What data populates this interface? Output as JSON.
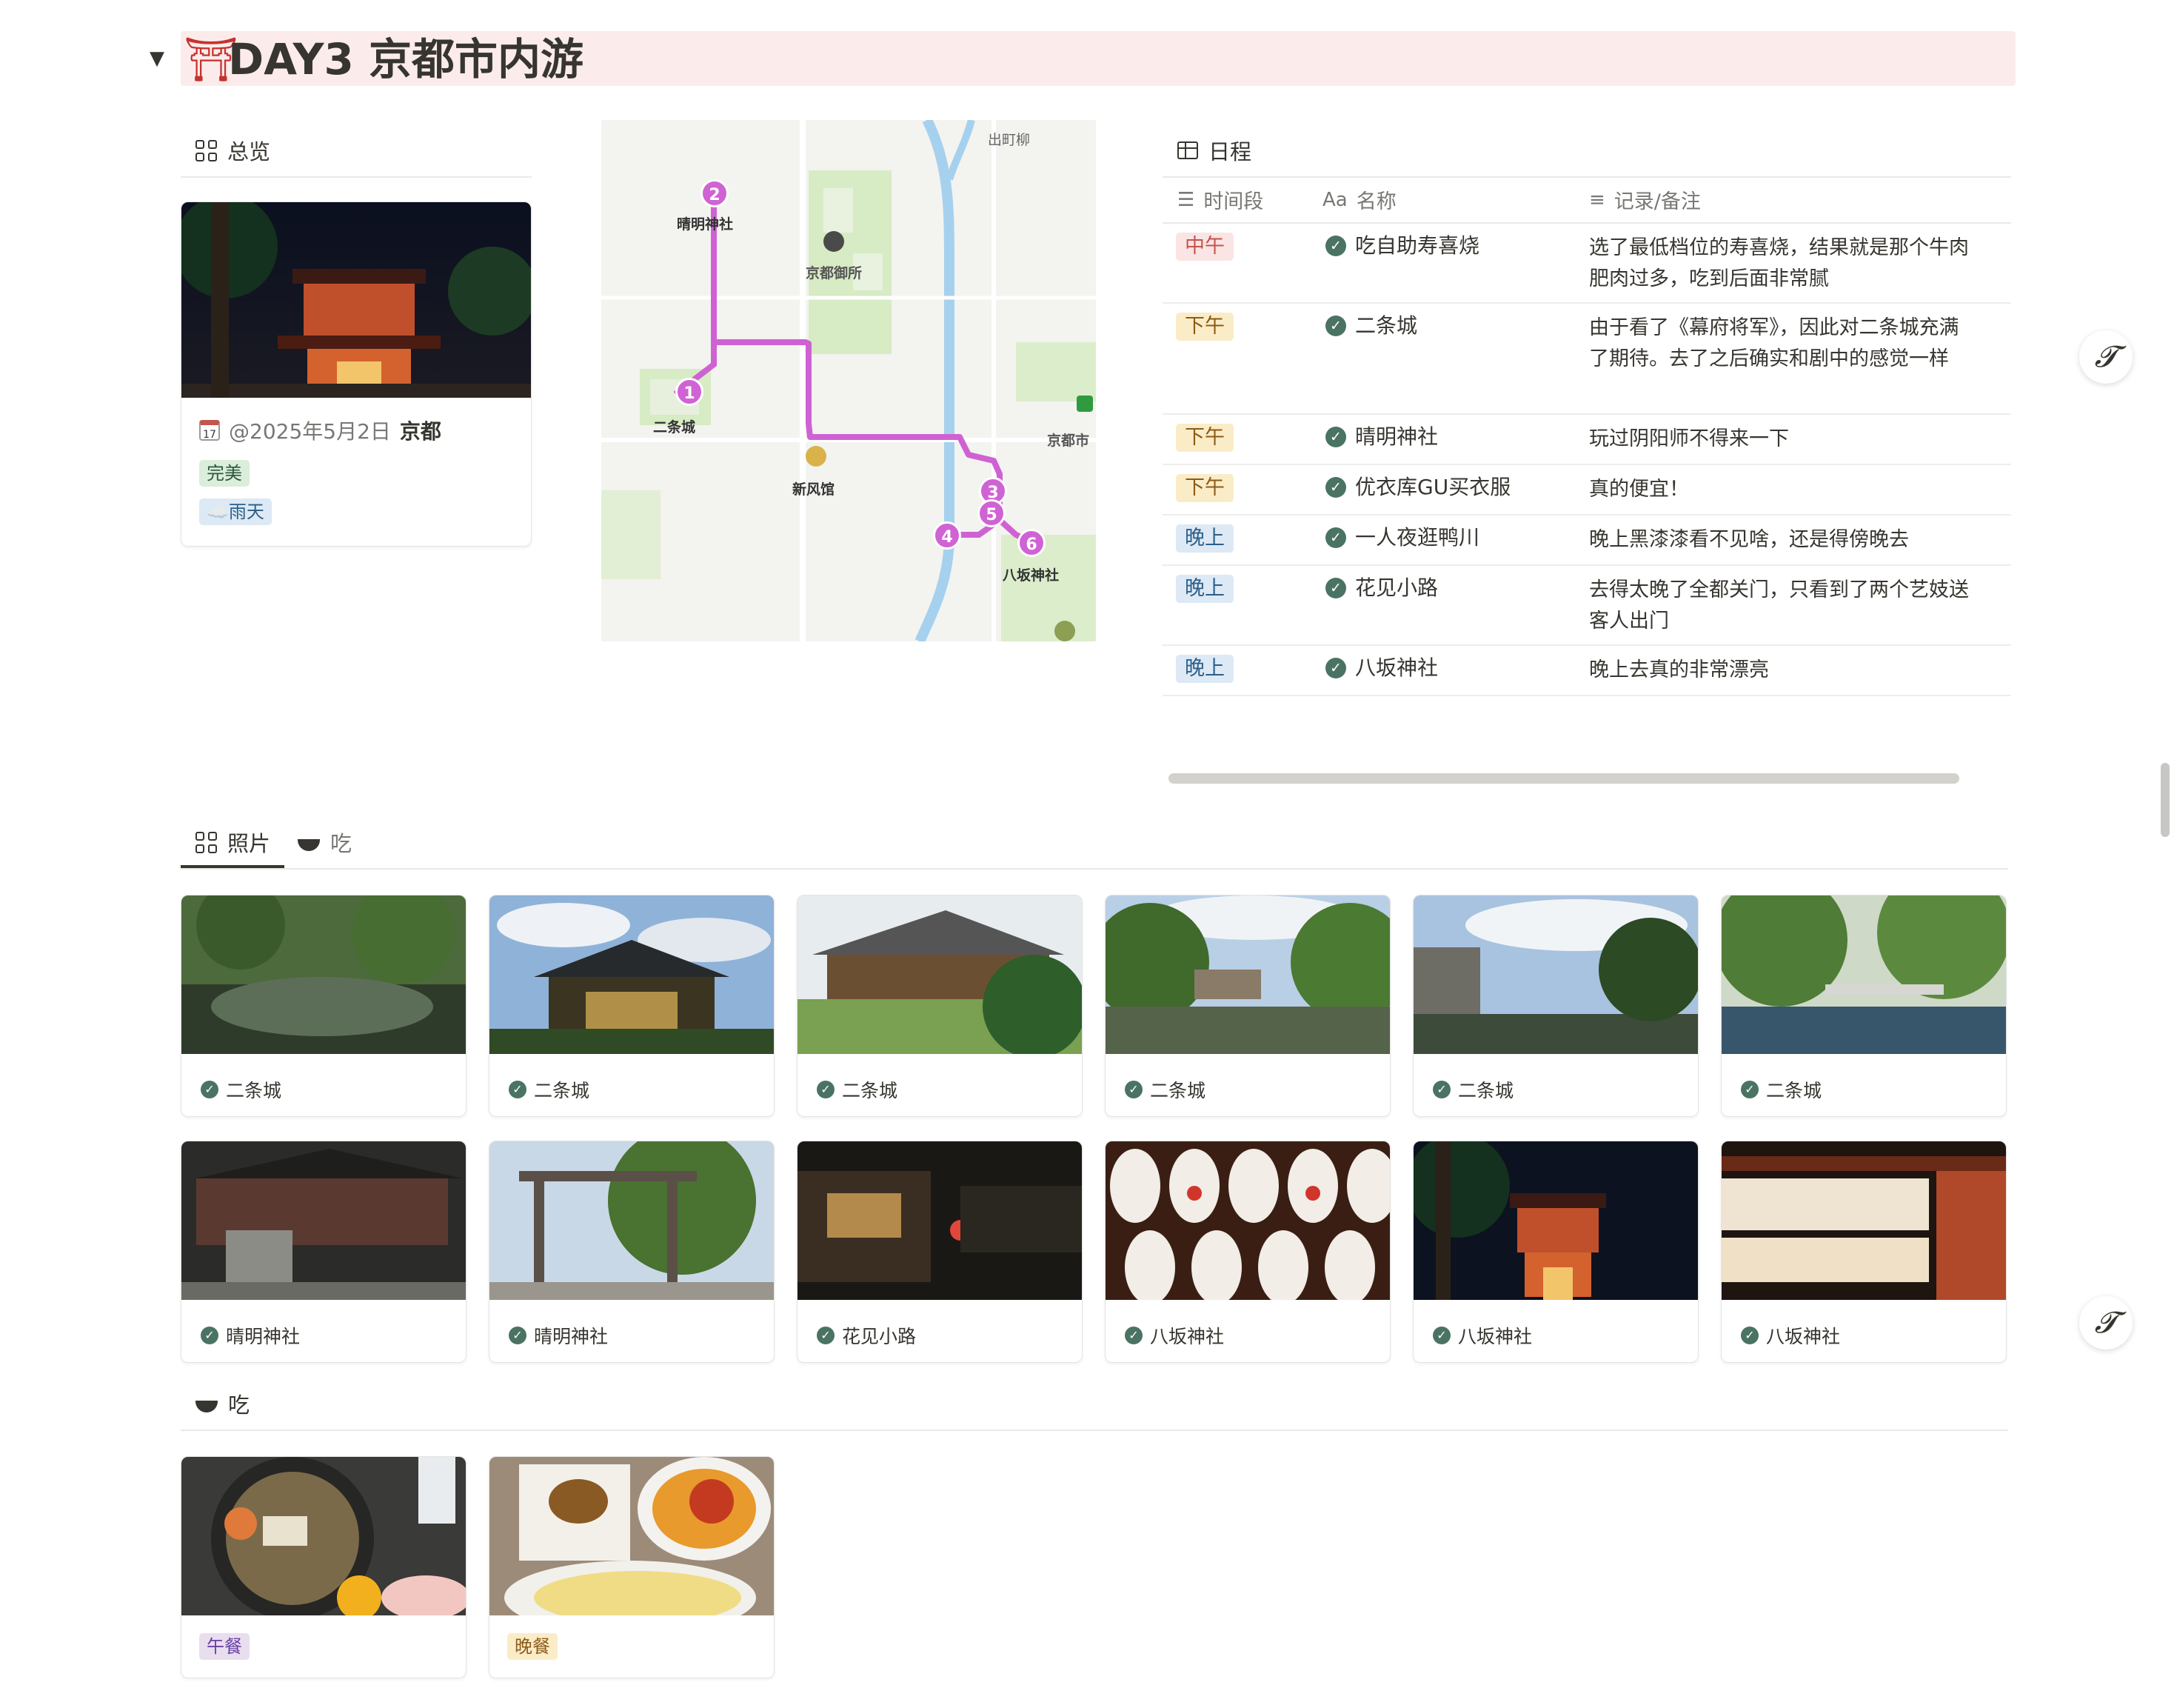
{
  "page": {
    "title_emoji": "⛩",
    "title": "DAY3 京都市内游"
  },
  "overview": {
    "view_label": "总览",
    "date_icon": "calendar-icon",
    "date": "@2025年5月2日",
    "place": "京都",
    "tags": [
      "完美",
      "☁️雨天"
    ]
  },
  "map": {
    "labels": {
      "demachi": "出町柳",
      "seimei": "晴明神社",
      "gosho": "京都御所",
      "nijo": "二条城",
      "shinpukan": "新风馆",
      "kyotoshi": "京都市",
      "yasaka": "八坂神社"
    },
    "pins": [
      "1",
      "2",
      "3",
      "4",
      "5",
      "6"
    ]
  },
  "schedule": {
    "view_label": "日程",
    "columns": [
      "时间段",
      "名称",
      "记录/备注"
    ],
    "column_icons": [
      "list-icon",
      "text-aa-icon",
      "lines-icon"
    ],
    "rows": [
      {
        "time": "中午",
        "name": "吃自助寿喜烧",
        "note": "选了最低档位的寿喜烧，结果就是那个牛肉肥肉过多，吃到后面非常腻",
        "color": "#fbe4e4",
        "text_color": "#c4554d"
      },
      {
        "time": "下午",
        "name": "二条城",
        "note": "由于看了《幕府将军》，因此对二条城充满了期待。去了之后确实和剧中的感觉一样",
        "color": "#fbecc8",
        "text_color": "#8b5b17"
      },
      {
        "time": "下午",
        "name": "晴明神社",
        "note": "玩过阴阳师不得来一下",
        "color": "#fbecc8",
        "text_color": "#8b5b17"
      },
      {
        "time": "下午",
        "name": "优衣库GU买衣服",
        "note": "真的便宜！",
        "color": "#fbecc8",
        "text_color": "#8b5b17"
      },
      {
        "time": "晚上",
        "name": "一人夜逛鸭川",
        "note": "晚上黑漆漆看不见啥，还是得傍晚去",
        "color": "#dde9f5",
        "text_color": "#2b5f8a"
      },
      {
        "time": "晚上",
        "name": "花见小路",
        "note": "去得太晚了全都关门，只看到了两个艺妓送客人出门",
        "color": "#dde9f5",
        "text_color": "#2b5f8a"
      },
      {
        "time": "晚上",
        "name": "八坂神社",
        "note": "晚上去真的非常漂亮",
        "color": "#dde9f5",
        "text_color": "#2b5f8a"
      }
    ]
  },
  "photos": {
    "tabs": [
      "照片",
      "吃"
    ],
    "items": [
      "二条城",
      "二条城",
      "二条城",
      "二条城",
      "二条城",
      "二条城",
      "晴明神社",
      "晴明神社",
      "花见小路",
      "八坂神社",
      "八坂神社",
      "八坂神社"
    ]
  },
  "food": {
    "view_label": "吃",
    "items": [
      {
        "tag": "午餐",
        "color": "#e8deee",
        "text_color": "#6940a5"
      },
      {
        "tag": "晚餐",
        "color": "#fbecc8",
        "text_color": "#8b5b17"
      }
    ]
  },
  "side_buttons": [
    "𝓣",
    "𝓣"
  ]
}
